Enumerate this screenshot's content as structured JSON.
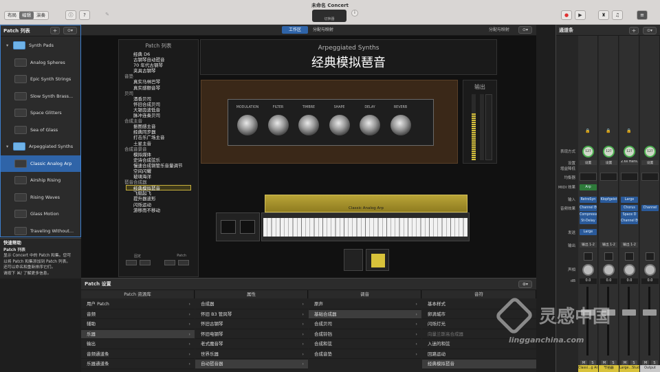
{
  "window": {
    "title": "未命名 Concert",
    "lcd_text": "切换器"
  },
  "toolbar": {
    "modes": [
      "布局",
      "编辑",
      "演奏"
    ],
    "active_mode": "编辑"
  },
  "left_panel": {
    "title": "Patch 列表",
    "items": [
      {
        "label": "Synth Pads",
        "folder": true
      },
      {
        "label": "Analog Spheres"
      },
      {
        "label": "Epic Synth Strings"
      },
      {
        "label": "Slow Synth Brass..."
      },
      {
        "label": "Space Glitters"
      },
      {
        "label": "Sea of Glass"
      },
      {
        "label": "Arpeggiated Synths",
        "folder": true
      },
      {
        "label": "Classic Analog Arp",
        "selected": true
      },
      {
        "label": "Airship Rising"
      },
      {
        "label": "Rising Waves"
      },
      {
        "label": "Glass Motion"
      },
      {
        "label": "Traveling Without..."
      }
    ]
  },
  "quick_help": {
    "title": "快速帮助",
    "heading": "Patch 列表",
    "line1": "显示 Concert 中的 Patch 和集。您可",
    "line2": "以将 Patch 和集添加到 Patch 列表。",
    "line3": "还可以命名和重新排序它们。",
    "line4": "请按下 ⌘/ 了解更多信息。"
  },
  "main_tabs": {
    "work": "工作区",
    "map": "分配与映射",
    "map_right": "分配与映射"
  },
  "patch_list_widget": {
    "title": "Patch 列表",
    "rows": [
      {
        "t": "经典 D6",
        "c": false
      },
      {
        "t": "古钢琴自动琶音",
        "c": false
      },
      {
        "t": "70 年代古钢琴",
        "c": false
      },
      {
        "t": "夹具古钢琴",
        "c": false
      },
      {
        "t": "音垫",
        "c": true
      },
      {
        "t": "真实马林巴琴",
        "c": false
      },
      {
        "t": "真实感颤音琴",
        "c": false
      },
      {
        "t": "贝司",
        "c": true
      },
      {
        "t": "酒香贝司",
        "c": false
      },
      {
        "t": "怀旧合成贝司",
        "c": false
      },
      {
        "t": "大锯齿波低音",
        "c": false
      },
      {
        "t": "脉冲连奏贝司",
        "c": false
      },
      {
        "t": "合成主音",
        "c": true
      },
      {
        "t": "振图感主音",
        "c": false
      },
      {
        "t": "经典同步器",
        "c": false
      },
      {
        "t": "打击乐广场主音",
        "c": false
      },
      {
        "t": "土星主音",
        "c": false
      },
      {
        "t": "合成音景音",
        "c": true
      },
      {
        "t": "模拟媒体",
        "c": false
      },
      {
        "t": "史诗合成弦乐",
        "c": false
      },
      {
        "t": "慢速合成铜管乐音量调节",
        "c": false
      },
      {
        "t": "空间闪耀",
        "c": false
      },
      {
        "t": "玻璃海洋",
        "c": false
      },
      {
        "t": "琶音合成器",
        "c": true
      },
      {
        "t": "经典模拟琶音",
        "c": false,
        "sel": true
      },
      {
        "t": "飞艇起飞",
        "c": false
      },
      {
        "t": "提升器波形",
        "c": false
      },
      {
        "t": "闪烁运动",
        "c": false
      },
      {
        "t": "游移而不移动",
        "c": false
      }
    ],
    "btn_fix": "固定",
    "btn_patch": "Patch"
  },
  "synth": {
    "subtitle": "Arpeggiated Synths",
    "name": "经典模拟琶音",
    "output_label": "输出",
    "knobs": [
      "MODULATION",
      "FILTER",
      "TIMBRE",
      "SHAPE",
      "DELAY",
      "REVERB"
    ],
    "keyboard_label": "Classic Analog Arp"
  },
  "patch_settings": {
    "title": "Patch 设置",
    "col_headers": [
      "Patch 资源库",
      "属性",
      "调音",
      "音符"
    ],
    "library": [
      {
        "label": "用户 Patch"
      },
      {
        "label": "音频"
      },
      {
        "label": "辅助"
      },
      {
        "label": "乐器",
        "sel": true
      },
      {
        "label": "输出"
      },
      {
        "label": "音频通道条"
      },
      {
        "label": "乐器通道条"
      }
    ],
    "attributes": [
      {
        "label": "合成器"
      },
      {
        "label": "怀旧 B3 管风琴"
      },
      {
        "label": "怀旧古钢琴"
      },
      {
        "label": "怀旧电钢琴"
      },
      {
        "label": "老式魔音琴"
      },
      {
        "label": "世界乐器"
      },
      {
        "label": "自动琶音器",
        "sel": true
      }
    ],
    "tuning": [
      {
        "label": "原声"
      },
      {
        "label": "基础合成器",
        "sel": true
      },
      {
        "label": "合成贝司"
      },
      {
        "label": "合成铃铛"
      },
      {
        "label": "合成和弦"
      },
      {
        "label": "合成音垫"
      }
    ],
    "notes": [
      {
        "label": "基本样式"
      },
      {
        "label": "卵滴城市"
      },
      {
        "label": "闪烁灯光"
      },
      {
        "label": "向量兰斯高合成器",
        "dim": true
      },
      {
        "label": "入迷的和弦"
      },
      {
        "label": "回路运动"
      },
      {
        "label": "经典模拟琶音",
        "sel": true
      }
    ]
  },
  "mixer": {
    "title": "通道条",
    "row_labels": [
      "表现方式",
      "设置",
      "增益降低",
      "均衡器",
      "MIDI 效果",
      "输入",
      "音频效果",
      "发送",
      "输出",
      "声相",
      "dB"
    ],
    "strips": [
      {
        "setting": "设置",
        "midi": "Arp",
        "input": "RetroSyn",
        "fx": [
          "Channel EQ",
          "Compressor",
          "St-Delay"
        ],
        "send": "Large",
        "output": "输出 1-2",
        "db": "0.0",
        "name": "Classi...g Arp",
        "color": "#d8c23a"
      },
      {
        "setting": "设置",
        "midi": "",
        "input": "Klopfgeist",
        "fx": [],
        "send": "",
        "output": "输出 1-2",
        "db": "0.0",
        "name": "节拍器",
        "color": "#d8c23a"
      },
      {
        "setting": "2.6s Hans...",
        "midi": "",
        "input": "Large",
        "fx": [
          "Chorus",
          "Space D",
          "Channel EQ"
        ],
        "send": "",
        "output": "输出 1-2",
        "db": "0.0",
        "name": "Large...Studio",
        "color": "#d8c23a"
      },
      {
        "setting": "设置",
        "midi": "",
        "input": "",
        "fx": [
          "Channel"
        ],
        "send": "",
        "output": "",
        "db": "0.0",
        "name": "Output",
        "color": "#c9c9c9"
      }
    ]
  },
  "watermark": {
    "text": "灵感中国",
    "url": "lingganchina.com"
  },
  "colors": {
    "accent": "#2f64a8",
    "gold": "#d8c23a",
    "wood": "#3a2818"
  }
}
